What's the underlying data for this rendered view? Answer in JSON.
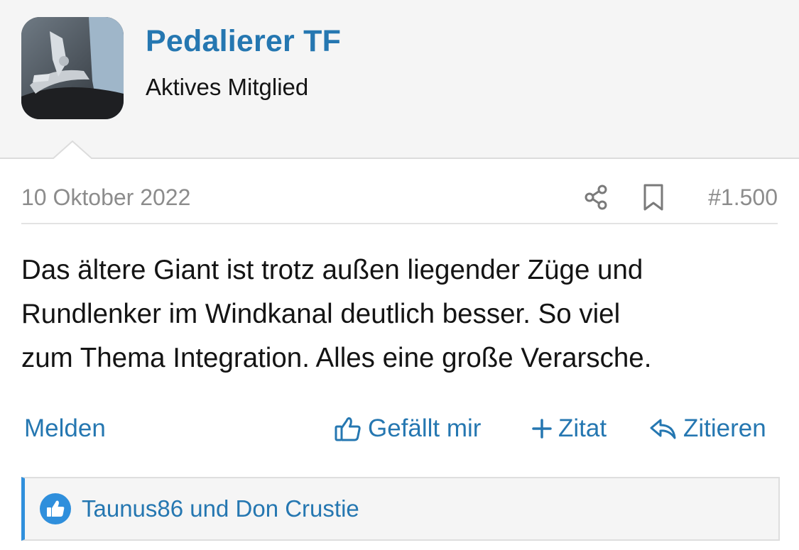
{
  "user": {
    "name": "Pedalierer TF",
    "title": "Aktives Mitglied"
  },
  "post": {
    "date": "10 Oktober 2022",
    "number": "#1.500",
    "body_lines": [
      "Das ältere Giant ist trotz außen liegender Züge und",
      "Rundlenker im Windkanal deutlich besser. So viel",
      "zum Thema Integration. Alles eine große Verarsche."
    ]
  },
  "actions": {
    "report": "Melden",
    "like": "Gefällt mir",
    "multiquote": "Zitat",
    "reply": "Zitieren"
  },
  "reactions": {
    "users": "Taunus86 und Don Crustie"
  },
  "icons": {
    "share": "share-icon",
    "bookmark": "bookmark-icon",
    "like": "thumbs-up-icon",
    "multiquote": "plus-icon",
    "reply": "reply-arrow-icon",
    "reaction": "like-reaction-icon"
  },
  "colors": {
    "link": "#2577b1",
    "reaction_accent": "#2f8fdc",
    "meta_text": "#8c8c8c"
  }
}
